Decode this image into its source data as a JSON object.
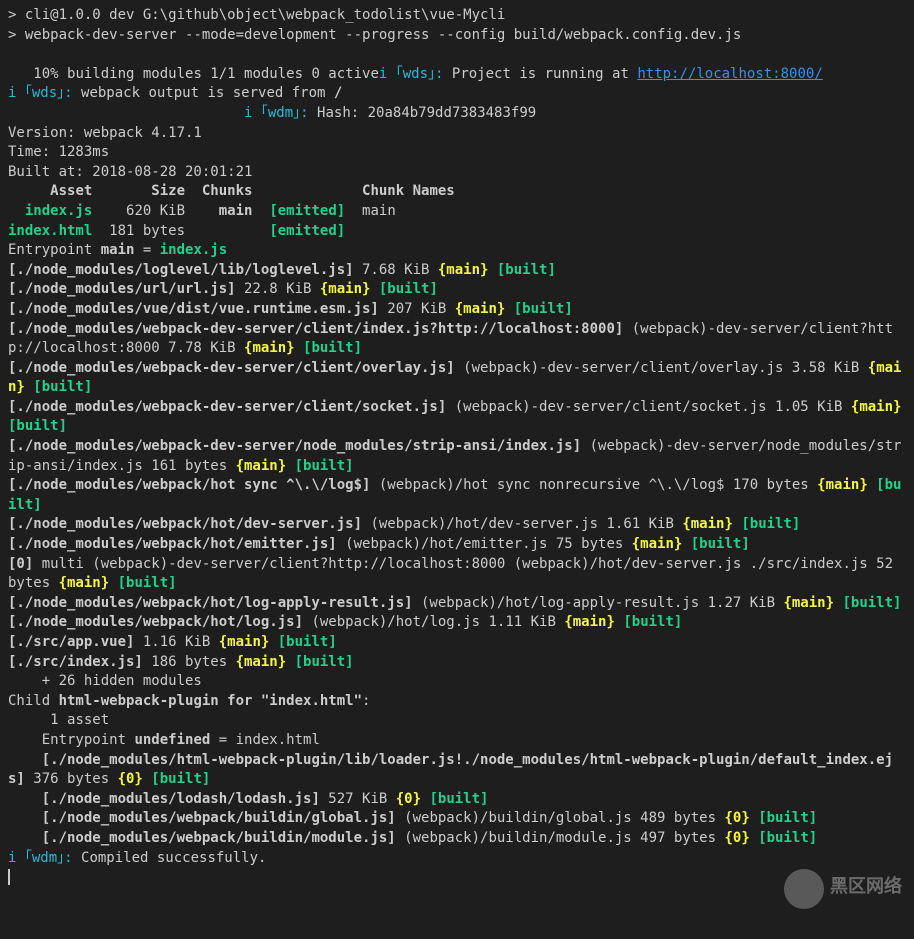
{
  "prompt1": {
    "marker": ">",
    "text": " cli@1.0.0 dev G:\\github\\object\\webpack_todolist\\vue-Mycli"
  },
  "prompt2": {
    "marker": ">",
    "text": " webpack-dev-server --mode=development --progress --config build/webpack.config.dev.js"
  },
  "progress": "   10% building modules 1/1 modules 0 active",
  "wds_i": "i",
  "wds_tag": " ｢wds｣:",
  "wds_running": " Project is running at ",
  "url": "http://localhost:8000/",
  "wds_served": " webpack output is served from ",
  "slash": "/",
  "wdm_i": "i",
  "wdm_tag": " ｢wdm｣:",
  "hash": " Hash: 20a84b79dd7383483f99",
  "version": "Version: webpack 4.17.1",
  "time": "Time: 1283ms",
  "built_at": "Built at: 2018-08-28 20:01:21",
  "header": "     Asset       Size  Chunks             Chunk Names",
  "asset1": {
    "name": "  index.js",
    "rest": "    620 KiB    ",
    "chunk": "main  ",
    "emitted": "[emitted]",
    "names": "  main"
  },
  "asset2": {
    "name": "index.html",
    "rest": "  181 bytes          ",
    "emitted": "[emitted]"
  },
  "entry_prefix": "Entrypoint ",
  "entry_main": "main",
  "entry_eq": " = ",
  "entry_file": "index.js",
  "mods": [
    {
      "p": "[./node_modules/loglevel/lib/loglevel.js]",
      "r": " 7.68 KiB ",
      "c": "{main}",
      "b": " [built]"
    },
    {
      "p": "[./node_modules/url/url.js]",
      "r": " 22.8 KiB ",
      "c": "{main}",
      "b": " [built]"
    },
    {
      "p": "[./node_modules/vue/dist/vue.runtime.esm.js]",
      "r": " 207 KiB ",
      "c": "{main}",
      "b": " [built]"
    }
  ],
  "wds_client": {
    "p": "[./node_modules/webpack-dev-server/client/index.js?http://localhost:8000]",
    "d": " (webpack)-dev-server/client?http://localhost:8000",
    "r": " 7.78 KiB ",
    "c": "{main}",
    "b": " [built]"
  },
  "wds_overlay": {
    "p": "[./node_modules/webpack-dev-server/client/overlay.js]",
    "d": " (webpack)-dev-server/client/overlay.js",
    "r": " 3.58 KiB ",
    "c": "{main}",
    "b": " [built]"
  },
  "wds_socket": {
    "p": "[./node_modules/webpack-dev-server/client/socket.js]",
    "d": " (webpack)-dev-server/client/socket.js",
    "r": " 1.05 KiB ",
    "c": "{main}",
    "b": " [built]"
  },
  "strip_ansi": {
    "p": "[./node_modules/webpack-dev-server/node_modules/strip-ansi/index.js]",
    "d": " (webpack)-dev-server/node_modules/strip-ansi/index.js",
    "r": " 161 bytes ",
    "c": "{main}",
    "b": " [built]"
  },
  "hot_sync": {
    "p": "[./node_modules/webpack/hot sync ^\\.\\/log$]",
    "d": " (webpack)/hot sync nonrecursive ^\\.\\/log$",
    "r": " 170 bytes ",
    "c": "{main}",
    "b": " [built]"
  },
  "hot_dev": {
    "p": "[./node_modules/webpack/hot/dev-server.js]",
    "d": " (webpack)/hot/dev-server.js",
    "r": " 1.61 KiB ",
    "c": "{main}",
    "b": " [built]"
  },
  "hot_emitter": {
    "p": "[./node_modules/webpack/hot/emitter.js]",
    "d": " (webpack)/hot/emitter.js",
    "r": " 75 bytes ",
    "c": "{main}",
    "b": " [built]"
  },
  "multi": {
    "p": "[0]",
    "d": " multi (webpack)-dev-server/client?http://localhost:8000 (webpack)/hot/dev-server.js ./src/index.js",
    "r": " 52 bytes ",
    "c": "{main}",
    "b": " [built]"
  },
  "log_apply": {
    "p": "[./node_modules/webpack/hot/log-apply-result.js]",
    "d": " (webpack)/hot/log-apply-result.js",
    "r": " 1.27 KiB ",
    "c": "{main}",
    "b": " [built]"
  },
  "hot_log": {
    "p": "[./node_modules/webpack/hot/log.js]",
    "d": " (webpack)/hot/log.js",
    "r": " 1.11 KiB ",
    "c": "{main}",
    "b": " [built]"
  },
  "app_vue": {
    "p": "[./src/app.vue]",
    "r": " 1.16 KiB ",
    "c": "{main}",
    "b": " [built]"
  },
  "src_index": {
    "p": "[./src/index.js]",
    "r": " 186 bytes ",
    "c": "{main}",
    "b": " [built]"
  },
  "hidden": "    + 26 hidden modules",
  "child_prefix": "Child ",
  "child_bold": "html-webpack-plugin for \"index.html\"",
  "child_colon": ":",
  "child_asset": "     1 asset",
  "child_entry_prefix": "    Entrypoint ",
  "child_entry_undef": "undefined",
  "child_entry_rest": " = index.html",
  "child_loader": {
    "p": "    [./node_modules/html-webpack-plugin/lib/loader.js!./node_modules/html-webpack-plugin/default_index.ejs]",
    "r": " 376 bytes ",
    "c": "{0}",
    "b": " [built]"
  },
  "child_lodash": {
    "p": "    [./node_modules/lodash/lodash.js]",
    "r": " 527 KiB ",
    "c": "{0}",
    "b": " [built]"
  },
  "child_global": {
    "p": "    [./node_modules/webpack/buildin/global.js]",
    "d": " (webpack)/buildin/global.js",
    "r": " 489 bytes ",
    "c": "{0}",
    "b": " [built]"
  },
  "child_module": {
    "p": "    [./node_modules/webpack/buildin/module.js]",
    "d": " (webpack)/buildin/module.js",
    "r": " 497 bytes ",
    "c": "{0}",
    "b": " [built]"
  },
  "compiled": " Compiled successfully.",
  "watermark": "黑区网络"
}
